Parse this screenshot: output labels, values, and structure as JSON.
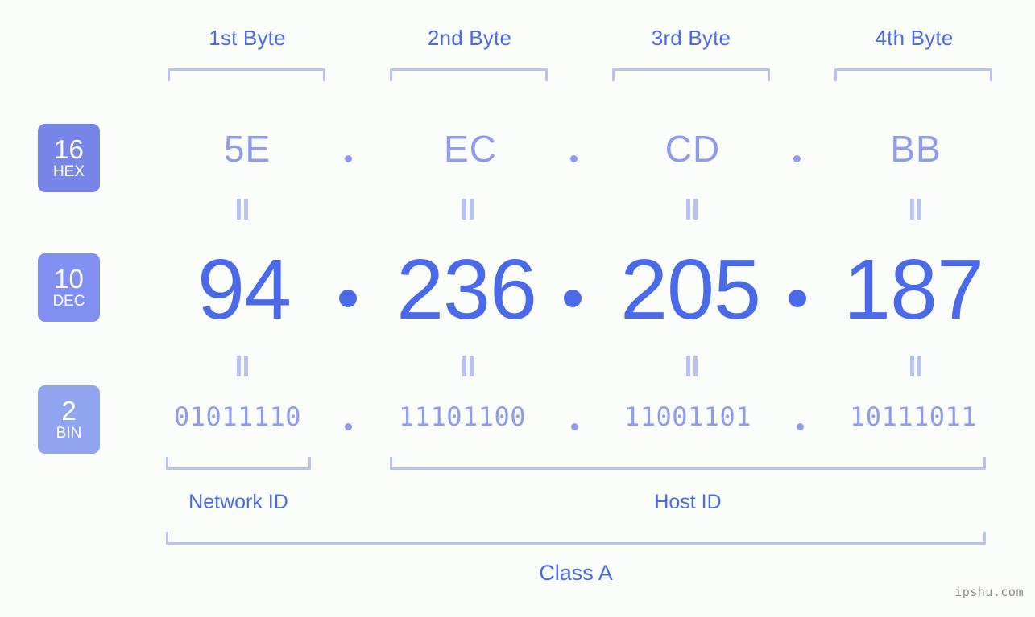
{
  "watermark": "ipshu.com",
  "byte_headers": [
    {
      "label": "1st Byte"
    },
    {
      "label": "2nd Byte"
    },
    {
      "label": "3rd Byte"
    },
    {
      "label": "4th Byte"
    }
  ],
  "radix_badges": [
    {
      "base": "16",
      "name": "HEX",
      "color": "#7786e8"
    },
    {
      "base": "10",
      "name": "DEC",
      "color": "#818ff0"
    },
    {
      "base": "2",
      "name": "BIN",
      "color": "#90a4f0"
    }
  ],
  "separator": ".",
  "rows": {
    "hex": {
      "label": "HEX",
      "base": "16",
      "octets": [
        "5E",
        "EC",
        "CD",
        "BB"
      ],
      "joined": "5E.EC.CD.BB"
    },
    "dec": {
      "label": "DEC",
      "base": "10",
      "octets": [
        "94",
        "236",
        "205",
        "187"
      ],
      "joined": "94.236.205.187"
    },
    "bin": {
      "label": "BIN",
      "base": "2",
      "octets": [
        "01011110",
        "11101100",
        "11001101",
        "10111011"
      ],
      "joined": "01011110.11101100.11001101.10111011"
    }
  },
  "equality_mark": "=",
  "segments": {
    "network_id": "Network ID",
    "host_id": "Host ID",
    "class": "Class A"
  },
  "colors": {
    "background": "#fafdfa",
    "accent": "#4a6ae8",
    "light_accent": "#8f9bef",
    "bracket": "#b9c2f5"
  }
}
